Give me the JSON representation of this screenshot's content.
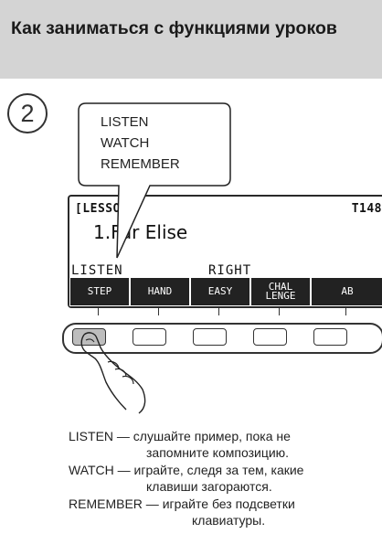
{
  "header": {
    "title": "Как заниматься с функциями уроков"
  },
  "step_number": "2",
  "callout": {
    "lines": [
      "LISTEN",
      "WATCH",
      "REMEMBER"
    ]
  },
  "display": {
    "lesson_label": "[LESSON]",
    "tempo": "T148",
    "song": "1.Fur Elise",
    "mode": "LISTEN",
    "hand": "RIGHT",
    "function_keys": [
      "STEP",
      "HAND",
      "EASY",
      "CHAL LENGE",
      "AB"
    ]
  },
  "buttons": {
    "count": 5,
    "pressed_index": 0
  },
  "legend": [
    {
      "term": "LISTEN",
      "line1": "слушайте пример, пока не",
      "line2": "запомните композицию."
    },
    {
      "term": "WATCH",
      "line1": "играйте, следя за тем, какие",
      "line2": "клавиши загораются."
    },
    {
      "term": "REMEMBER",
      "line1": "играйте без подсветки",
      "line2": "клавиатуры."
    }
  ],
  "dash": "—"
}
